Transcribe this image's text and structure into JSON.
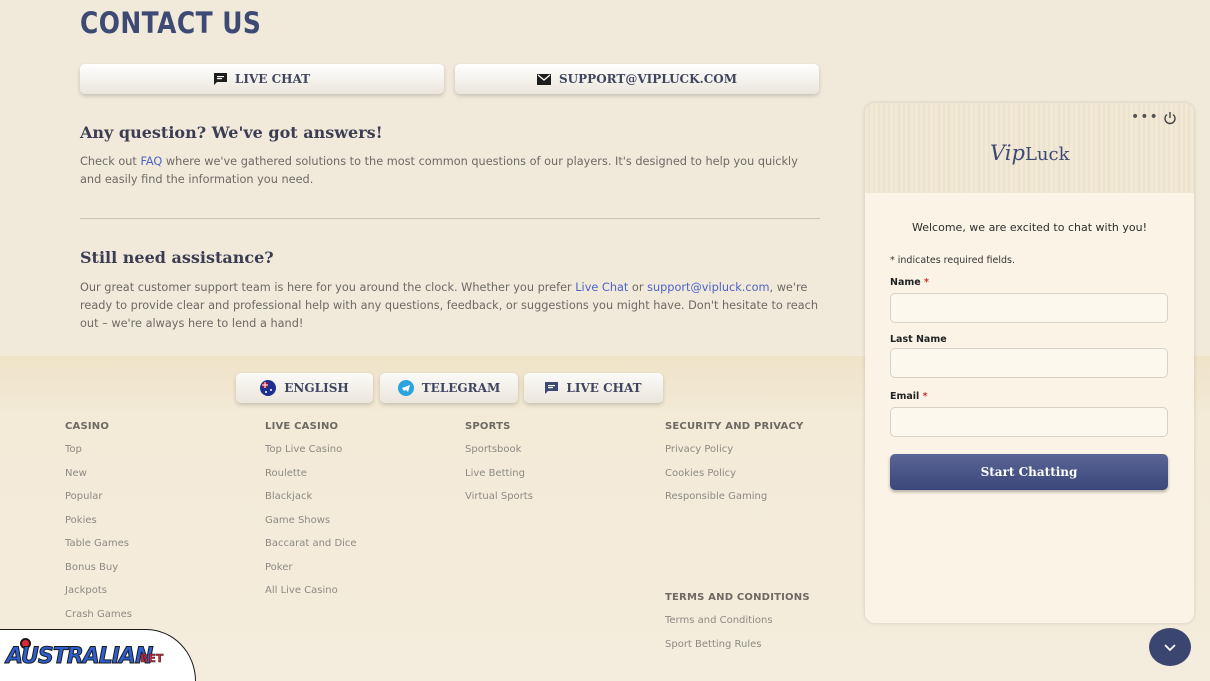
{
  "page": {
    "heading": "CONTACT US",
    "buttons": {
      "live_chat": "LIVE CHAT",
      "support_email": "SUPPORT@VIPLUCK.COM"
    }
  },
  "faq": {
    "title": "Any question? We've got answers!",
    "text_before": "Check out ",
    "link": "FAQ",
    "text_after": " where we've gathered solutions to the most common questions of our players. It's designed to help you quickly and easily find the information you need."
  },
  "assistance": {
    "title": "Still need assistance?",
    "text_1": "Our great customer support team is here for you around the clock. Whether you prefer ",
    "link_chat": "Live Chat",
    "text_2": " or ",
    "link_email": "support@vipluck.com",
    "text_3": ", we're ready to provide clear and professional help with any questions, feedback, or suggestions you might have. Don't hesitate to reach out – we're always here to lend a hand!"
  },
  "footer_buttons": {
    "english": "ENGLISH",
    "telegram": "TELEGRAM",
    "live_chat": "LIVE CHAT"
  },
  "footer": {
    "casino": {
      "title": "CASINO",
      "items": [
        "Top",
        "New",
        "Popular",
        "Pokies",
        "Table Games",
        "Bonus Buy",
        "Jackpots",
        "Crash Games"
      ]
    },
    "live_casino": {
      "title": "LIVE CASINO",
      "items": [
        "Top Live Casino",
        "Roulette",
        "Blackjack",
        "Game Shows",
        "Baccarat and Dice",
        "Poker",
        "All Live Casino"
      ]
    },
    "sports": {
      "title": "SPORTS",
      "items": [
        "Sportsbook",
        "Live Betting",
        "Virtual Sports"
      ]
    },
    "security": {
      "title": "SECURITY AND PRIVACY",
      "items": [
        "Privacy Policy",
        "Cookies Policy",
        "Responsible Gaming"
      ]
    },
    "terms": {
      "title": "TERMS AND CONDITIONS",
      "items": [
        "Terms and Conditions",
        "Sport Betting Rules"
      ]
    }
  },
  "chat": {
    "logo_vip": "Vip",
    "logo_luck": "Luck",
    "welcome": "Welcome, we are excited to chat with you!",
    "required_note": "* indicates required fields.",
    "name_label": "Name",
    "last_name_label": "Last Name",
    "email_label": "Email",
    "required_star": "*",
    "name_value": "",
    "last_name_value": "",
    "email_value": "",
    "start_button": "Start Chatting"
  },
  "badge": {
    "brand": "AUSTRALIAN",
    "suffix": "BET"
  },
  "colors": {
    "accent": "#3d4a73",
    "link": "#4e63c7",
    "background": "#f1eadb"
  }
}
